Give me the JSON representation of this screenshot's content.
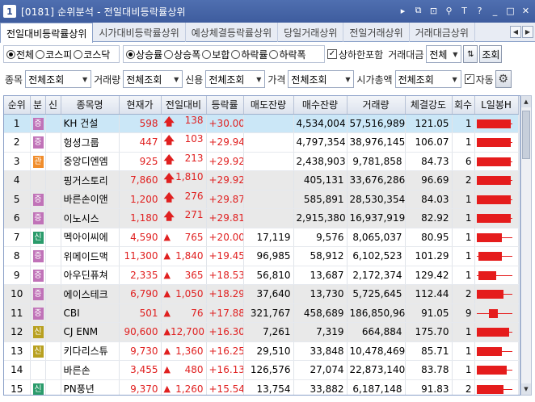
{
  "window": {
    "number": "1",
    "title": "[0181] 순위분석 - 전일대비등락률상위",
    "controls": [
      "▸",
      "⧉",
      "⊡",
      "⚲",
      "T",
      "?",
      "_",
      "□",
      "✕"
    ]
  },
  "tabs": [
    {
      "label": "전일대비등락률상위",
      "active": true
    },
    {
      "label": "시가대비등락률상위",
      "active": false
    },
    {
      "label": "예상체결등락률상위",
      "active": false
    },
    {
      "label": "당일거래상위",
      "active": false
    },
    {
      "label": "전일거래상위",
      "active": false
    },
    {
      "label": "거래대금상위",
      "active": false
    }
  ],
  "filters": {
    "market": [
      {
        "label": "전체",
        "on": true
      },
      {
        "label": "코스피",
        "on": false
      },
      {
        "label": "코스닥",
        "on": false
      }
    ],
    "direction": [
      {
        "label": "상승률",
        "on": true
      },
      {
        "label": "상승폭",
        "on": false
      },
      {
        "label": "보합",
        "on": false
      },
      {
        "label": "하락률",
        "on": false
      },
      {
        "label": "하락폭",
        "on": false
      }
    ],
    "include_limit_label": "상하한포함",
    "include_limit_checked": true,
    "amount_label": "거래대금",
    "amount_value": "전체",
    "query_button": "조회",
    "stock_label": "종목",
    "stock_value": "전체조회",
    "volume_label": "거래량",
    "volume_value": "전체조회",
    "credit_label": "신용",
    "credit_value": "전체조회",
    "price_label": "가격",
    "price_value": "전체조회",
    "mktcap_label": "시가총액",
    "mktcap_value": "전체조회",
    "auto_label": "자동",
    "auto_checked": true
  },
  "table": {
    "headers": [
      "순위",
      "분",
      "신",
      "종목명",
      "현재가",
      "전일대비",
      "등락률",
      "매도잔량",
      "매수잔량",
      "거래량",
      "체결강도",
      "회수",
      "L일봉H"
    ],
    "rows": [
      {
        "rank": "1",
        "badge": "증",
        "badge_type": "gang",
        "sin": "",
        "name": "KH 건설",
        "price": "598",
        "arrow": "up",
        "change": "138",
        "rate": "+30.00",
        "ask": "",
        "bid": "4,534,004",
        "volume": "57,516,989",
        "strength": "121.05",
        "count": "1",
        "bar_from": 0.0,
        "bar_to": 0.95,
        "state": "sel"
      },
      {
        "rank": "2",
        "badge": "증",
        "badge_type": "gang",
        "sin": "",
        "name": "헝셩그룹",
        "price": "447",
        "arrow": "up",
        "change": "103",
        "rate": "+29.94",
        "ask": "",
        "bid": "4,797,354",
        "volume": "38,976,145",
        "strength": "106.07",
        "count": "1",
        "bar_from": 0.0,
        "bar_to": 0.95,
        "state": ""
      },
      {
        "rank": "3",
        "badge": "관",
        "badge_type": "gwan",
        "sin": "",
        "name": "중앙디엔엠",
        "price": "925",
        "arrow": "up",
        "change": "213",
        "rate": "+29.92",
        "ask": "",
        "bid": "2,438,903",
        "volume": "9,781,858",
        "strength": "84.73",
        "count": "6",
        "bar_from": 0.0,
        "bar_to": 0.95,
        "state": ""
      },
      {
        "rank": "4",
        "badge": "",
        "badge_type": "",
        "sin": "",
        "name": "핑거스토리",
        "price": "7,860",
        "arrow": "up",
        "change": "1,810",
        "rate": "+29.92",
        "ask": "",
        "bid": "405,131",
        "volume": "33,676,286",
        "strength": "96.69",
        "count": "2",
        "bar_from": 0.0,
        "bar_to": 0.95,
        "state": "gray"
      },
      {
        "rank": "5",
        "badge": "증",
        "badge_type": "gang",
        "sin": "",
        "name": "바른손이앤",
        "price": "1,200",
        "arrow": "up",
        "change": "276",
        "rate": "+29.87",
        "ask": "",
        "bid": "585,891",
        "volume": "28,530,354",
        "strength": "84.03",
        "count": "1",
        "bar_from": 0.0,
        "bar_to": 0.95,
        "state": "gray"
      },
      {
        "rank": "6",
        "badge": "증",
        "badge_type": "gang",
        "sin": "",
        "name": "이노시스",
        "price": "1,180",
        "arrow": "up",
        "change": "271",
        "rate": "+29.81",
        "ask": "",
        "bid": "2,915,380",
        "volume": "16,937,919",
        "strength": "82.92",
        "count": "1",
        "bar_from": 0.0,
        "bar_to": 0.95,
        "state": "gray"
      },
      {
        "rank": "7",
        "badge": "신",
        "badge_type": "sin",
        "sin": "",
        "name": "멕아이씨에",
        "price": "4,590",
        "arrow": "tri",
        "change": "765",
        "rate": "+20.00",
        "ask": "17,119",
        "bid": "9,576",
        "volume": "8,065,037",
        "strength": "80.95",
        "count": "1",
        "bar_from": 0.0,
        "bar_to": 0.7,
        "state": ""
      },
      {
        "rank": "8",
        "badge": "증",
        "badge_type": "gang",
        "sin": "",
        "name": "위메이드맥",
        "price": "11,300",
        "arrow": "tri",
        "change": "1,840",
        "rate": "+19.45",
        "ask": "96,985",
        "bid": "58,912",
        "volume": "6,102,523",
        "strength": "101.29",
        "count": "1",
        "bar_from": 0.05,
        "bar_to": 0.72,
        "state": ""
      },
      {
        "rank": "9",
        "badge": "증",
        "badge_type": "gang",
        "sin": "",
        "name": "아우딘퓨쳐",
        "price": "2,335",
        "arrow": "tri",
        "change": "365",
        "rate": "+18.53",
        "ask": "56,810",
        "bid": "13,687",
        "volume": "2,172,374",
        "strength": "129.42",
        "count": "1",
        "bar_from": 0.05,
        "bar_to": 0.55,
        "state": ""
      },
      {
        "rank": "10",
        "badge": "증",
        "badge_type": "gang",
        "sin": "",
        "name": "에이스테크",
        "price": "6,790",
        "arrow": "tri",
        "change": "1,050",
        "rate": "+18.29",
        "ask": "37,640",
        "bid": "13,730",
        "volume": "5,725,645",
        "strength": "112.44",
        "count": "2",
        "bar_from": 0.0,
        "bar_to": 0.75,
        "state": "gray"
      },
      {
        "rank": "11",
        "badge": "증",
        "badge_type": "gang",
        "sin": "",
        "name": "CBI",
        "price": "501",
        "arrow": "tri",
        "change": "76",
        "rate": "+17.88",
        "ask": "321,767",
        "bid": "458,689",
        "volume": "186,850,962",
        "strength": "91.05",
        "count": "9",
        "bar_from": 0.35,
        "bar_to": 0.6,
        "state": "gray"
      },
      {
        "rank": "12",
        "badge": "신",
        "badge_type": "sin2",
        "sin": "",
        "name": "CJ ENM",
        "price": "90,600",
        "arrow": "tri",
        "change": "12,700",
        "rate": "+16.30",
        "ask": "7,261",
        "bid": "7,319",
        "volume": "664,884",
        "strength": "175.70",
        "count": "1",
        "bar_from": 0.0,
        "bar_to": 0.9,
        "state": "gray"
      },
      {
        "rank": "13",
        "badge": "신",
        "badge_type": "sin2",
        "sin": "",
        "name": "키다리스튜",
        "price": "9,730",
        "arrow": "tri",
        "change": "1,360",
        "rate": "+16.25",
        "ask": "29,510",
        "bid": "33,848",
        "volume": "10,478,469",
        "strength": "85.71",
        "count": "1",
        "bar_from": 0.0,
        "bar_to": 0.7,
        "state": ""
      },
      {
        "rank": "14",
        "badge": "",
        "badge_type": "",
        "sin": "",
        "name": "바른손",
        "price": "3,455",
        "arrow": "tri",
        "change": "480",
        "rate": "+16.13",
        "ask": "126,576",
        "bid": "27,074",
        "volume": "22,873,140",
        "strength": "83.78",
        "count": "1",
        "bar_from": 0.0,
        "bar_to": 0.85,
        "state": ""
      },
      {
        "rank": "15",
        "badge": "신",
        "badge_type": "sin",
        "sin": "",
        "name": "PN풍년",
        "price": "9,370",
        "arrow": "tri",
        "change": "1,260",
        "rate": "+15.54",
        "ask": "13,754",
        "bid": "33,882",
        "volume": "6,187,148",
        "strength": "91.83",
        "count": "2",
        "bar_from": 0.0,
        "bar_to": 0.75,
        "state": ""
      }
    ]
  },
  "colors": {
    "accent": "#3e5c9e",
    "up": "#e02020",
    "selected_row": "#cbe7f7",
    "gray_row": "#e9e9e9"
  }
}
